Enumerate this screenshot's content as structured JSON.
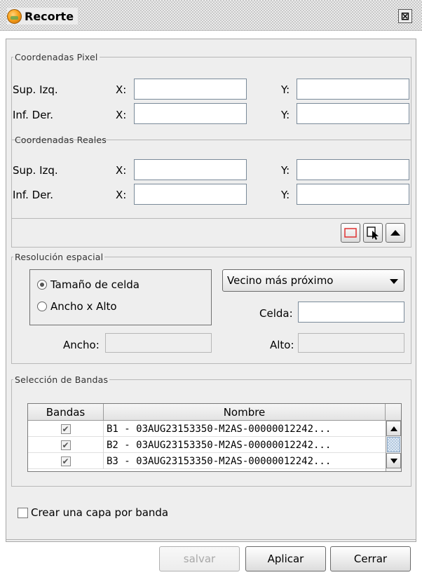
{
  "window": {
    "title": "Recorte",
    "close_label": "⊠"
  },
  "coord_pixel": {
    "legend": "Coordenadas Pixel",
    "row1_label": "Sup. Izq.",
    "row2_label": "Inf. Der.",
    "x_label": "X:",
    "y_label": "Y:",
    "ul_x": "",
    "ul_y": "",
    "lr_x": "",
    "lr_y": ""
  },
  "coord_real": {
    "legend": "Coordenadas Reales",
    "row1_label": "Sup. Izq.",
    "row2_label": "Inf. Der.",
    "x_label": "X:",
    "y_label": "Y:",
    "ul_x": "",
    "ul_y": "",
    "lr_x": "",
    "lr_y": ""
  },
  "tools": [
    "rectangle-select-icon",
    "pointer-select-icon",
    "collapse-up-icon"
  ],
  "resolution": {
    "legend": "Resolución espacial",
    "option_cell": "Tamaño de celda",
    "option_wh": "Ancho x Alto",
    "selected_option": "Tamaño de celda",
    "interpolation": "Vecino más próximo",
    "cell_label": "Celda:",
    "cell_value": "",
    "width_label": "Ancho:",
    "width_value": "",
    "height_label": "Alto:",
    "height_value": ""
  },
  "bands": {
    "legend": "Selección de Bandas",
    "columns": [
      "Bandas",
      "Nombre"
    ],
    "rows": [
      {
        "checked": true,
        "name": "B1 - 03AUG23153350-M2AS-00000012242..."
      },
      {
        "checked": true,
        "name": "B2 - 03AUG23153350-M2AS-00000012242..."
      },
      {
        "checked": true,
        "name": "B3 - 03AUG23153350-M2AS-00000012242..."
      }
    ]
  },
  "layer_per_band": {
    "label": "Crear una capa por banda",
    "checked": false
  },
  "buttons": {
    "save": "salvar",
    "apply": "Aplicar",
    "close": "Cerrar"
  },
  "colors": {
    "title_stripe": "#c8c8c8",
    "panel_bg": "#eeeeee",
    "rect_tool": "#e03030"
  }
}
